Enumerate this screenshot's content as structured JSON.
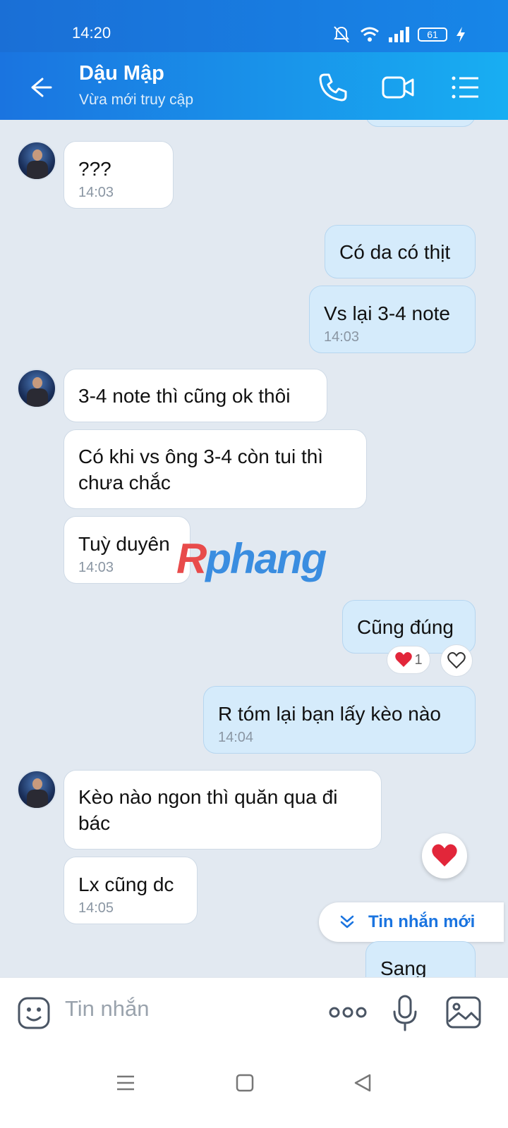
{
  "status_bar": {
    "time": "14:20",
    "battery": "61"
  },
  "header": {
    "name": "Dậu Mập",
    "status": "Vừa mới truy cập"
  },
  "messages": [
    {
      "text": "???",
      "time": "14:03"
    },
    {
      "text": "Có da có thịt"
    },
    {
      "text": "Vs lại 3-4 note",
      "time": "14:03"
    },
    {
      "text": "3-4 note thì cũng ok thôi"
    },
    {
      "text_line1": "Có khi vs ông 3-4 còn tui thì",
      "text_line2": "chưa chắc"
    },
    {
      "text": "Tuỳ duyên",
      "time": "14:03"
    },
    {
      "text": "Cũng đúng",
      "reaction_count": "1"
    },
    {
      "text": "R tóm lại bạn lấy kèo nào",
      "time": "14:04"
    },
    {
      "text_line1": "Kèo nào ngon thì quăn qua đi",
      "text_line2": "bác"
    },
    {
      "text": "Lx cũng dc",
      "time": "14:05"
    },
    {
      "text": "Sang"
    }
  ],
  "watermark": {
    "part1": "R",
    "part2": "phang"
  },
  "new_message_button": "Tin nhắn mới",
  "composer": {
    "placeholder": "Tin nhắn"
  },
  "colors": {
    "header": "#1a74e0",
    "outgoing_bubble": "#d5ebfb",
    "incoming_bubble": "#ffffff",
    "background": "#e2e9f1"
  }
}
